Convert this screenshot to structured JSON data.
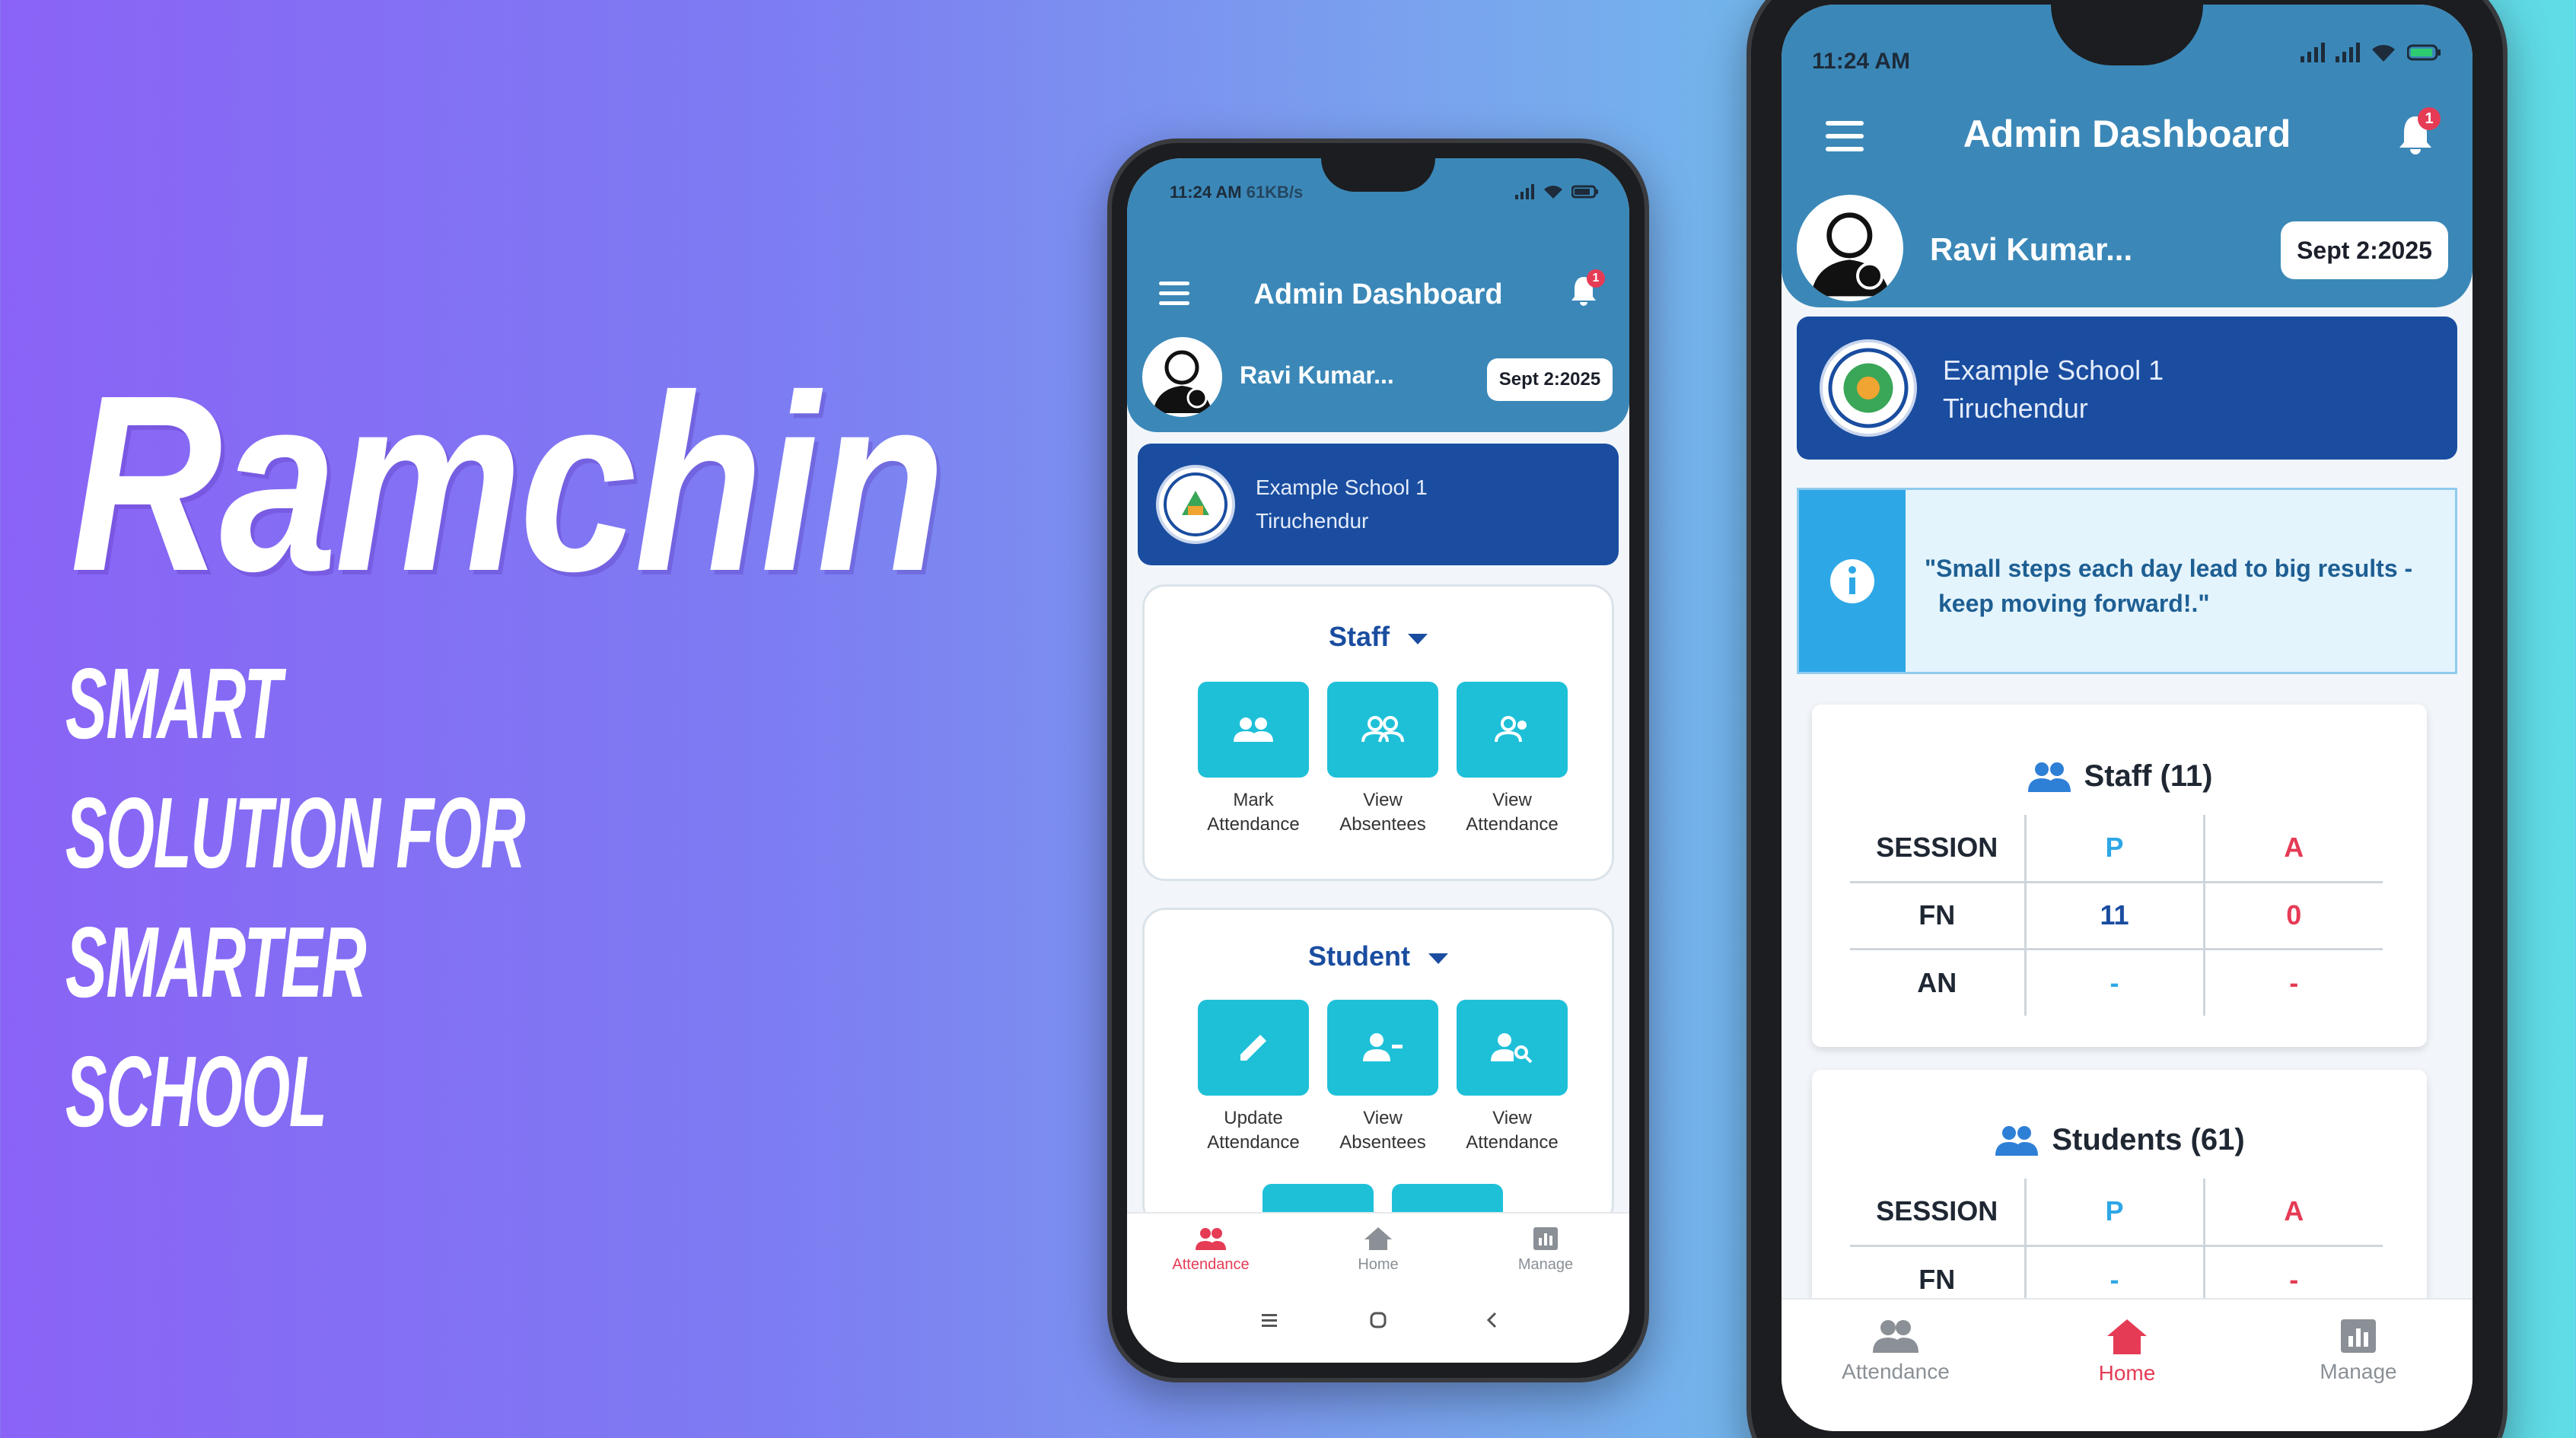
{
  "brand": {
    "title": "Ramchin",
    "tagline_line1": "Smart Solution for",
    "tagline_line2": "Smarter School"
  },
  "colors": {
    "header_blue": "#3b88b8",
    "school_card": "#1a4da0",
    "tile_cyan": "#1ec0d8",
    "accent_pink": "#e53b55",
    "info_blue": "#2ea7e6"
  },
  "phone1": {
    "status_time": "11:24 AM",
    "status_speed": "61KB/s",
    "header_title": "Admin Dashboard",
    "notification_count": "1",
    "user_name": "Ravi Kumar...",
    "date": "Sept 2:2025",
    "school_name": "Example School 1",
    "school_city": "Tiruchendur",
    "sections": [
      {
        "title": "Staff",
        "tiles": [
          {
            "label1": "Mark",
            "label2": "Attendance",
            "icon": "people-icon"
          },
          {
            "label1": "View",
            "label2": "Absentees",
            "icon": "people-outline-icon"
          },
          {
            "label1": "View",
            "label2": "Attendance",
            "icon": "person-outline-icon"
          }
        ]
      },
      {
        "title": "Student",
        "tiles": [
          {
            "label1": "Update",
            "label2": "Attendance",
            "icon": "pencil-icon"
          },
          {
            "label1": "View",
            "label2": "Absentees",
            "icon": "person-remove-icon"
          },
          {
            "label1": "View",
            "label2": "Attendance",
            "icon": "person-search-icon"
          }
        ]
      }
    ],
    "nav": [
      {
        "label": "Attendance",
        "icon": "people-icon",
        "active": true
      },
      {
        "label": "Home",
        "icon": "home-icon",
        "active": false
      },
      {
        "label": "Manage",
        "icon": "chart-icon",
        "active": false
      }
    ]
  },
  "phone2": {
    "status_time": "11:24 AM",
    "header_title": "Admin Dashboard",
    "notification_count": "1",
    "user_name": "Ravi Kumar...",
    "date": "Sept 2:2025",
    "school_name": "Example School 1",
    "school_city": "Tiruchendur",
    "quote_line1": "\"Small steps each day lead to big results -",
    "quote_line2": "keep moving forward!.\"",
    "staff": {
      "title": "Staff (11)",
      "head": [
        "SESSION",
        "P",
        "A"
      ],
      "rows": [
        [
          "FN",
          "11",
          "0"
        ],
        [
          "AN",
          "-",
          "-"
        ]
      ]
    },
    "students": {
      "title": "Students (61)",
      "head": [
        "SESSION",
        "P",
        "A"
      ],
      "rows": [
        [
          "FN",
          "-",
          "-"
        ]
      ]
    },
    "nav": [
      {
        "label": "Attendance",
        "icon": "people-icon",
        "active": false
      },
      {
        "label": "Home",
        "icon": "home-icon",
        "active": true
      },
      {
        "label": "Manage",
        "icon": "chart-icon",
        "active": false
      }
    ]
  }
}
